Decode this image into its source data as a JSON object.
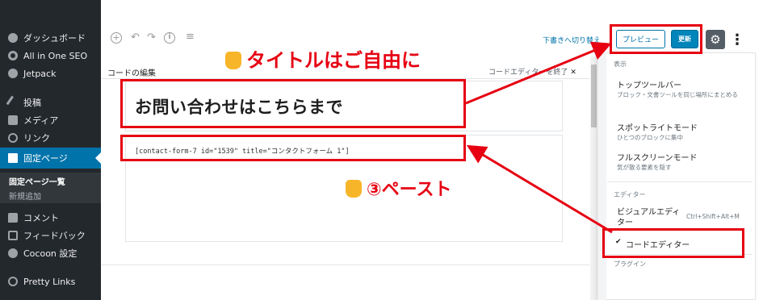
{
  "sidebar": {
    "items": [
      {
        "label": "ダッシュボード",
        "icon": "dashboard-icon"
      },
      {
        "label": "All in One SEO",
        "icon": "gear-icon"
      },
      {
        "label": "Jetpack",
        "icon": "jetpack-icon"
      },
      {
        "label": "投稿",
        "icon": "pin-icon"
      },
      {
        "label": "メディア",
        "icon": "media-icon"
      },
      {
        "label": "リンク",
        "icon": "link-icon"
      },
      {
        "label": "固定ページ",
        "icon": "page-icon",
        "active": true
      },
      {
        "label": "コメント",
        "icon": "comment-icon"
      },
      {
        "label": "フィードバック",
        "icon": "feedback-icon"
      },
      {
        "label": "Cocoon 設定",
        "icon": "cocoon-icon"
      },
      {
        "label": "Pretty Links",
        "icon": "link-icon"
      }
    ],
    "submenu": [
      {
        "label": "固定ページ一覧",
        "current": true
      },
      {
        "label": "新規追加"
      }
    ]
  },
  "toolbar": {
    "save_draft": "下書きへ切り替え",
    "preview_label": "プレビュー",
    "update_label": "更新",
    "settings_icon": "gear-icon",
    "more_icon": "more-vertical-icon"
  },
  "editor": {
    "code_header": "コードの編集",
    "exit_code_editor": "コードエディターを終了",
    "exit_x": "✕",
    "title": "お問い合わせはこちらまで",
    "content": "[contact-form-7 id=\"1539\" title=\"コンタクトフォーム 1\"]"
  },
  "menu": {
    "view_label": "表示",
    "top_toolbar": "トップツールバー",
    "top_toolbar_help": "ブロック・文書ツールを同じ場所にまとめる",
    "spotlight": "スポットライトモード",
    "spotlight_help": "ひとつのブロックに集中",
    "fullscreen": "フルスクリーンモード",
    "fullscreen_help": "気が散る要素を隠す",
    "editor_label": "エディター",
    "visual_editor": "ビジュアルエディター",
    "visual_shortcut": "Ctrl+Shift+Alt+M",
    "code_editor": "コードエディター",
    "plugins_label": "プラグイン"
  },
  "annotations": {
    "title_hint": "タイトルはご自由に",
    "paste_hint": "③ペースト"
  },
  "colors": {
    "admin_sidebar": "#23282d",
    "active_blue": "#0073aa",
    "annotation_red": "#e60012"
  }
}
